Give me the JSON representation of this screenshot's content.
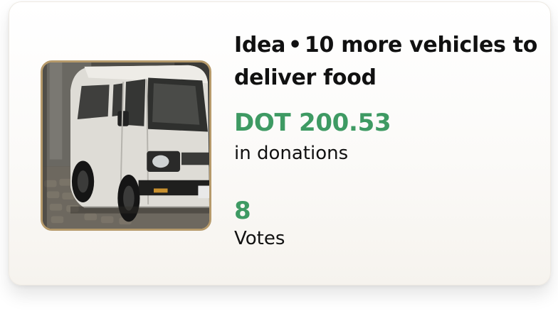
{
  "card": {
    "category": "Idea",
    "separator": "•",
    "title": "10 more vehicles to deliver food",
    "image_alt": "white delivery van",
    "amount": "DOT 200.53",
    "amount_label": "in donations",
    "votes": "8",
    "votes_label": "Votes"
  },
  "colors": {
    "accent_green": "#3e9a63",
    "thumbnail_border": "#b69a6b",
    "text": "#111111"
  }
}
